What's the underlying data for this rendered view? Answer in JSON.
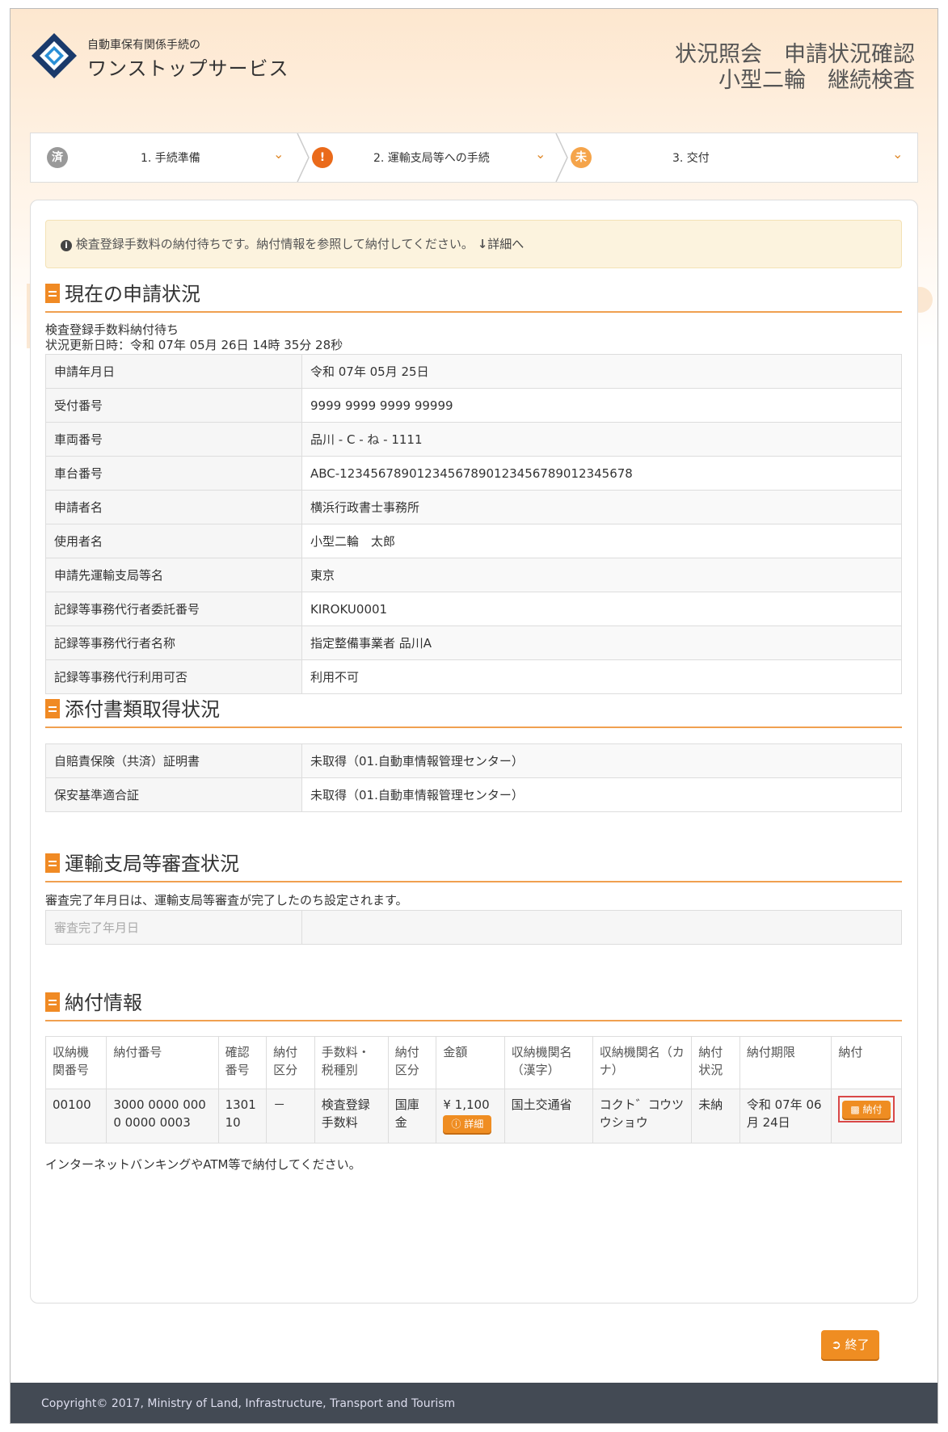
{
  "header": {
    "logo_sub": "自動車保有関係手続の",
    "logo_main": "ワンストップサービス",
    "title_line1": "状況照会　申請状況確認",
    "title_line2": "小型二輪　継続検査"
  },
  "steps": [
    {
      "badge": "済",
      "label": "1. 手続準備",
      "color": "#999999"
    },
    {
      "badge": "!",
      "label": "2. 運輸支局等への手続",
      "color": "#ea6a1a"
    },
    {
      "badge": "未",
      "label": "3. 交付",
      "color": "#f5a44a"
    }
  ],
  "alert": {
    "message": "検査登録手数料の納付待ちです。納付情報を参照して納付してください。",
    "link": "詳細へ"
  },
  "status_section": {
    "title": "現在の申請状況",
    "status_text": "検査登録手数料納付待ち",
    "updated_text": "状況更新日時：令和 07年 05月 26日 14時 35分 28秒",
    "rows": [
      {
        "key": "申請年月日",
        "value": "令和 07年 05月 25日"
      },
      {
        "key": "受付番号",
        "value": "9999 9999 9999 99999"
      },
      {
        "key": "車両番号",
        "value": "品川 - C - ね - 1111"
      },
      {
        "key": "車台番号",
        "value": "ABC-12345678901234567890123456789012345678"
      },
      {
        "key": "申請者名",
        "value": "横浜行政書士事務所"
      },
      {
        "key": "使用者名",
        "value": "小型二輪　太郎"
      },
      {
        "key": "申請先運輸支局等名",
        "value": "東京"
      },
      {
        "key": "記録等事務代行者委託番号",
        "value": "KIROKU0001"
      },
      {
        "key": "記録等事務代行者名称",
        "value": "指定整備事業者 品川A"
      },
      {
        "key": "記録等事務代行利用可否",
        "value": "利用不可"
      }
    ]
  },
  "attach_section": {
    "title": "添付書類取得状況",
    "rows": [
      {
        "key": "自賠責保険（共済）証明書",
        "value": "未取得（01.自動車情報管理センター）"
      },
      {
        "key": "保安基準適合証",
        "value": "未取得（01.自動車情報管理センター）"
      }
    ]
  },
  "review_section": {
    "title": "運輸支局等審査状況",
    "note": "審査完了年月日は、運輸支局等審査が完了したのち設定されます。",
    "rows": [
      {
        "key": "審査完了年月日",
        "value": ""
      }
    ]
  },
  "payment_section": {
    "title": "納付情報",
    "headers": [
      "収納機関番号",
      "納付番号",
      "確認番号",
      "納付区分",
      "手数料・税種別",
      "納付区分",
      "金額",
      "収納機関名（漢字）",
      "収納機関名（カナ）",
      "納付状況",
      "納付期限",
      "納付"
    ],
    "row": {
      "agency_no": "00100",
      "pay_no": "3000 0000 0000 0000 0003",
      "confirm_no": "130110",
      "pay_div": "－",
      "fee_type": "検査登録手数料",
      "pay_kind": "国庫金",
      "amount": "¥ 1,100",
      "detail_btn": "詳細",
      "agency_kanji": "国土交通省",
      "agency_kana": "コクト゛コウツウショウ",
      "status": "未納",
      "deadline": "令和 07年 06月 24日",
      "pay_btn": "納付"
    },
    "note": "インターネットバンキングやATM等で納付してください。"
  },
  "end_button": "終了",
  "footer": "Copyright© 2017, Ministry of Land, Infrastructure, Transport and Tourism"
}
